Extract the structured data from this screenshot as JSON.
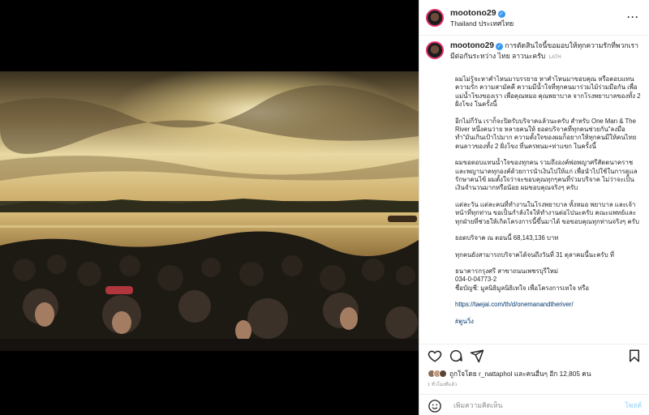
{
  "post": {
    "username": "mootono29",
    "location": "Thailand ประเทศไทย",
    "caption_title": "การตัดสินใจนี้ขอมอบให้ทุกความรักที่พวกเรามีต่อกันระหว่าง ไทย ลาวนะครับ",
    "caption_lang": "LATH",
    "paragraphs": [
      "ผมไม่รู้จะหาคำไหนมาบรรยาย หาคำไหนมาขอบคุณ หรือตอบแทนความรัก ความสามัคคี ความมีน้ำใจที่ทุกคนมาร่วมไม้ร่วมมือกัน เพื่อ แม่น้ำโขงของเรา เพื่อคุณหมอ คุณพยาบาล จากโรงพยาบาลของทั้ง 2 ฝั่งโขง ในครั้งนี้",
      "อีกไม่กี่วัน เราก็จะปิดรับบริจาคแล้วนะครับ สำหรับ One Man & The River หนึ่งคนว่าย หลายคนให้ ยอดบริจาคที่ทุกคนช่วยกัน\"ลงมือทำ\"มันเกินเป้าไปมาก ความตั้งใจของผมก็อยากให้ทุกคนมีให้คนไทย คนลาวของทั้ง 2 ฝั่งโขง ที่นครพนม+ท่าแขก ในครั้งนี้",
      "ผมขอตอบแทนน้ำใจของทุกคน รวมถึงองค์พ่อพญาศรีสัตตนาคราช และพญานาคทุกองค์ด้วยการนำเงินไปให้แก่ เพื่อนำไปใช้ในการดูแลรักษาคนไข้ ผมตั้งใจว่าจะขอบคุณทุกๆคนที่ร่วมบริจาค ไม่ว่าจะเป็นเงินจำนวนมากหรือน้อย ผมขอบคุณจริงๆ ครับ",
      "แต่ละวัน แต่ละคนที่ทำงานในโรงพยาบาล ทั้งหมอ พยาบาล และเจ้าหน้าที่ทุกท่าน ขอเป็นกำลังใจให้ทำงานต่อไปนะครับ คณะแพทย์และทุกฝ่ายที่ช่วยให้เกิดโครงการนี้ขึ้นมาได้ ขอขอบคุณทุกท่านจริงๆ ครับ",
      "ยอดบริจาค ณ ตอนนี้ 68,143,136 บาท",
      "ทุกคนยังสามารถบริจาคได้จนถึงวันที่ 31 ตุลาคมนี้นะครับ ที่",
      "ธนาคารกรุงศรี สาขาถนนเพชรบุรีใหม่\n034-0-04773-2\nชื่อบัญชี: มูลนิธิมูลนิธิเทใจ เพื่อโครงการเทใจ หรือ",
      "https://taejai.com/th/d/onemanandtheriver/",
      "#ตูนวิ่ง"
    ],
    "link": "https://taejai.com/th/d/onemanandtheriver/",
    "likes_text": "ถูกใจโดย r_nattaphol และคนอื่นๆ อีก 12,805 คน",
    "liked_by_user": "r_nattaphol",
    "likes_count": "12,805",
    "time": "1 ชั่วโมงที่แล้ว",
    "comment_placeholder": "เพิ่มความคิดเห็น",
    "post_label": "โพสต์"
  },
  "icons": {
    "more": "more-options-icon",
    "like": "heart-icon",
    "comment": "comment-icon",
    "share": "share-icon",
    "save": "bookmark-icon",
    "emoji": "emoji-icon"
  },
  "colors": {
    "verified": "#3897f0",
    "link": "#00376b",
    "post_button": "#b2dffc"
  }
}
